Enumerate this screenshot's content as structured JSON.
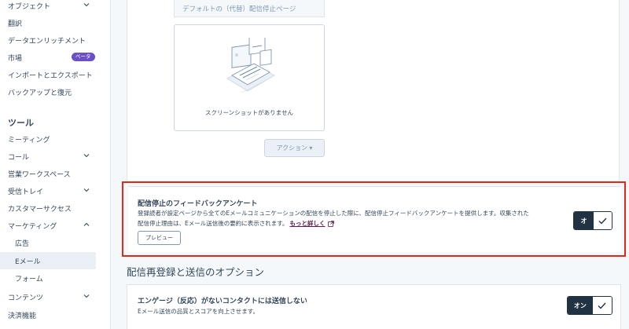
{
  "sidebar": {
    "items": [
      {
        "label": "オブジェクト"
      },
      {
        "label": "翻訳"
      },
      {
        "label": "データエンリッチメント"
      },
      {
        "label": "市場"
      },
      {
        "label": "インポートとエクスポート"
      },
      {
        "label": "バックアップと復元"
      }
    ],
    "beta_badge": "ベータ",
    "tools_heading": "ツール",
    "tools": [
      {
        "label": "ミーティング"
      },
      {
        "label": "コール"
      },
      {
        "label": "営業ワークスペース"
      },
      {
        "label": "受信トレイ"
      },
      {
        "label": "カスタマーサクセス"
      },
      {
        "label": "マーケティング"
      },
      {
        "label": "広告"
      },
      {
        "label": "Eメール"
      },
      {
        "label": "フォーム"
      },
      {
        "label": "コンテンツ"
      },
      {
        "label": "決済機能"
      }
    ]
  },
  "unsubscribe_page": {
    "default_label": "デフォルトの（代替）配信停止ページ",
    "no_screenshot": "スクリーンショットがありません",
    "action_button": "アクション ▾"
  },
  "feedback_survey": {
    "title": "配信停止のフィードバックアンケート",
    "description_line1": "登録読者が設定ページから全てのEメールコミュニケーションの配信を停止した際に、配信停止フィードバックアンケートを提供します。収集された",
    "description_line2": "配信停止理由は、Eメール送信後の要約に表示されます。",
    "learn_more": "もっと詳しく",
    "preview_button": "プレビュー",
    "toggle_label": "オ"
  },
  "resubscribe_section": {
    "heading": "配信再登録と送信のオプション"
  },
  "engagement": {
    "title": "エンゲージ（反応）がないコンタクトには送信しない",
    "description": "Eメール送信の品質とスコアを向上させます。",
    "toggle_label": "オン"
  },
  "colors": {
    "highlight": "#e0281b",
    "toggle_dark": "#213343",
    "beta": "#6a4fc7",
    "link": "#5c1a4e"
  }
}
